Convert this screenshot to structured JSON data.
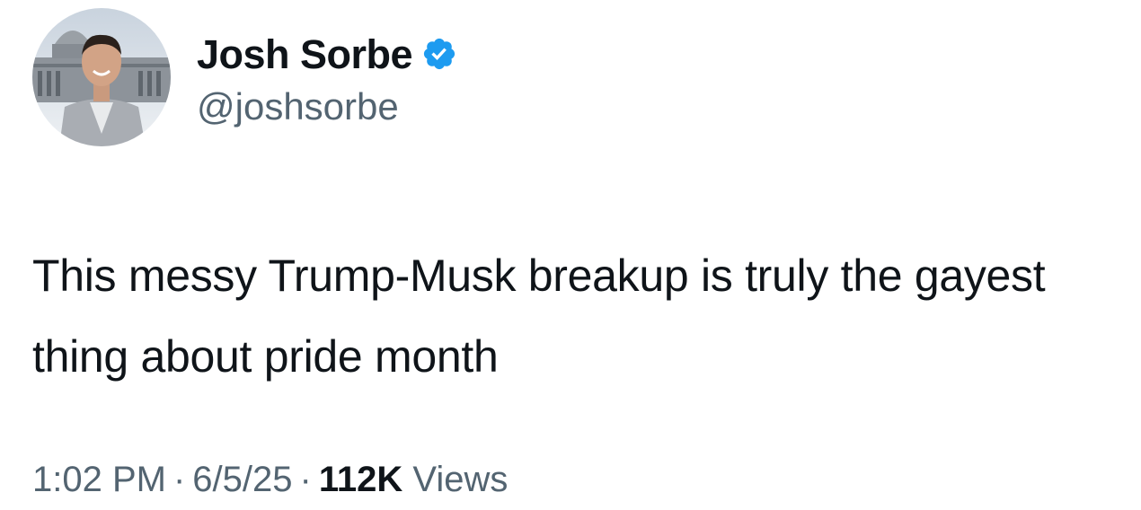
{
  "author": {
    "display_name": "Josh Sorbe",
    "handle": "@joshsorbe",
    "verified": true
  },
  "tweet": {
    "text": "This messy Trump-Musk breakup is truly the gayest thing about pride month"
  },
  "meta": {
    "time": "1:02 PM",
    "separator": "·",
    "date": "6/5/25",
    "views_count": "112K",
    "views_label": "Views"
  },
  "icons": {
    "verified": "verified-badge-icon"
  },
  "colors": {
    "text_primary": "#0f1419",
    "text_secondary": "#536471",
    "verified_blue": "#1d9bf0",
    "background": "#ffffff"
  }
}
